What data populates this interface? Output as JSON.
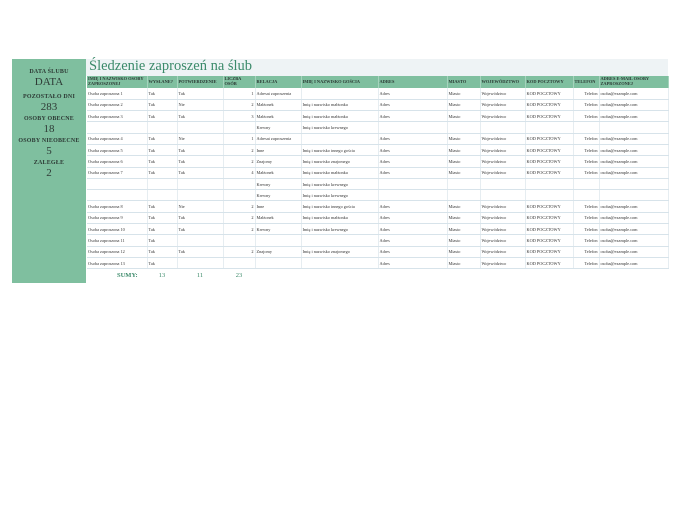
{
  "title": "Śledzenie zaproszeń na ślub",
  "sidebar": {
    "date_label": "DATA ŚLUBU",
    "date_value": "DATA",
    "remaining_label": "POZOSTAŁO DNI",
    "remaining_value": "283",
    "present_label": "OSOBY OBECNE",
    "present_value": "18",
    "absent_label": "OSOBY NIEOBECNE",
    "absent_value": "5",
    "pending_label": "ZALEGŁE",
    "pending_value": "2"
  },
  "table": {
    "headers": [
      "IMIĘ I NAZWISKO OSOBY ZAPROSZONEJ",
      "WYSŁANE?",
      "POTWIERDZENIE",
      "LICZBA OSÓB",
      "RELACJA",
      "IMIĘ I NAZWISKO GOŚCIA",
      "ADRES",
      "MIASTO",
      "WOJEWÓDZTWO",
      "KOD POCZTOWY",
      "TELEFON",
      "ADRES E-MAIL OSOBY ZAPROSZONEJ"
    ],
    "rows": [
      [
        "Osoba zaproszona 1",
        "Tak",
        "Tak",
        "1",
        "Adresat zaproszenia",
        "",
        "Adres",
        "Miasto",
        "Województwo",
        "KOD POCZTOWY",
        "Telefon",
        "osoba@example.com"
      ],
      [
        "Osoba zaproszona 2",
        "Tak",
        "Nie",
        "2",
        "Małżonek",
        "Imię i nazwisko małżonka",
        "Adres",
        "Miasto",
        "Województwo",
        "KOD POCZTOWY",
        "Telefon",
        "osoba@example.com"
      ],
      [
        "Osoba zaproszona 3",
        "Tak",
        "Tak",
        "3",
        "Małżonek",
        "Imię i nazwisko małżonka",
        "Adres",
        "Miasto",
        "Województwo",
        "KOD POCZTOWY",
        "Telefon",
        "osoba@example.com"
      ],
      [
        "",
        "",
        "",
        "",
        "Krewny",
        "Imię i nazwisko krewnego",
        "",
        "",
        "",
        "",
        "",
        ""
      ],
      [
        "Osoba zaproszona 4",
        "Tak",
        "Nie",
        "1",
        "Adresat zaproszenia",
        "",
        "Adres",
        "Miasto",
        "Województwo",
        "KOD POCZTOWY",
        "Telefon",
        "osoba@example.com"
      ],
      [
        "Osoba zaproszona 5",
        "Tak",
        "Tak",
        "2",
        "Inne",
        "Imię i nazwisko innego gościa",
        "Adres",
        "Miasto",
        "Województwo",
        "KOD POCZTOWY",
        "Telefon",
        "osoba@example.com"
      ],
      [
        "Osoba zaproszona 6",
        "Tak",
        "Tak",
        "2",
        "Znajomy",
        "Imię i nazwisko znajomego",
        "Adres",
        "Miasto",
        "Województwo",
        "KOD POCZTOWY",
        "Telefon",
        "osoba@example.com"
      ],
      [
        "Osoba zaproszona 7",
        "Tak",
        "Tak",
        "4",
        "Małżonek",
        "Imię i nazwisko małżonka",
        "Adres",
        "Miasto",
        "Województwo",
        "KOD POCZTOWY",
        "Telefon",
        "osoba@example.com"
      ],
      [
        "",
        "",
        "",
        "",
        "Krewny",
        "Imię i nazwisko krewnego",
        "",
        "",
        "",
        "",
        "",
        ""
      ],
      [
        "",
        "",
        "",
        "",
        "Krewny",
        "Imię i nazwisko krewnego",
        "",
        "",
        "",
        "",
        "",
        ""
      ],
      [
        "Osoba zaproszona 8",
        "Tak",
        "Nie",
        "2",
        "Inne",
        "Imię i nazwisko innego gościa",
        "Adres",
        "Miasto",
        "Województwo",
        "KOD POCZTOWY",
        "Telefon",
        "osoba@example.com"
      ],
      [
        "Osoba zaproszona 9",
        "Tak",
        "Tak",
        "2",
        "Małżonek",
        "Imię i nazwisko małżonka",
        "Adres",
        "Miasto",
        "Województwo",
        "KOD POCZTOWY",
        "Telefon",
        "osoba@example.com"
      ],
      [
        "Osoba zaproszona 10",
        "Tak",
        "Tak",
        "2",
        "Krewny",
        "Imię i nazwisko krewnego",
        "Adres",
        "Miasto",
        "Województwo",
        "KOD POCZTOWY",
        "Telefon",
        "osoba@example.com"
      ],
      [
        "Osoba zaproszona 11",
        "Tak",
        "",
        "",
        "",
        "",
        "Adres",
        "Miasto",
        "Województwo",
        "KOD POCZTOWY",
        "Telefon",
        "osoba@example.com"
      ],
      [
        "Osoba zaproszona 12",
        "Tak",
        "Tak",
        "2",
        "Znajomy",
        "Imię i nazwisko znajomego",
        "Adres",
        "Miasto",
        "Województwo",
        "KOD POCZTOWY",
        "Telefon",
        "osoba@example.com"
      ],
      [
        "Osoba zaproszona 13",
        "Tak",
        "",
        "",
        "",
        "",
        "Adres",
        "Miasto",
        "Województwo",
        "KOD POCZTOWY",
        "Telefon",
        "osoba@example.com"
      ]
    ],
    "totals_label": "SUMY:",
    "totals": [
      "13",
      "11",
      "23"
    ]
  },
  "colors": {
    "accent": "#7fbf9f",
    "title": "#3b8a6a",
    "title_band": "#eef3f5"
  }
}
